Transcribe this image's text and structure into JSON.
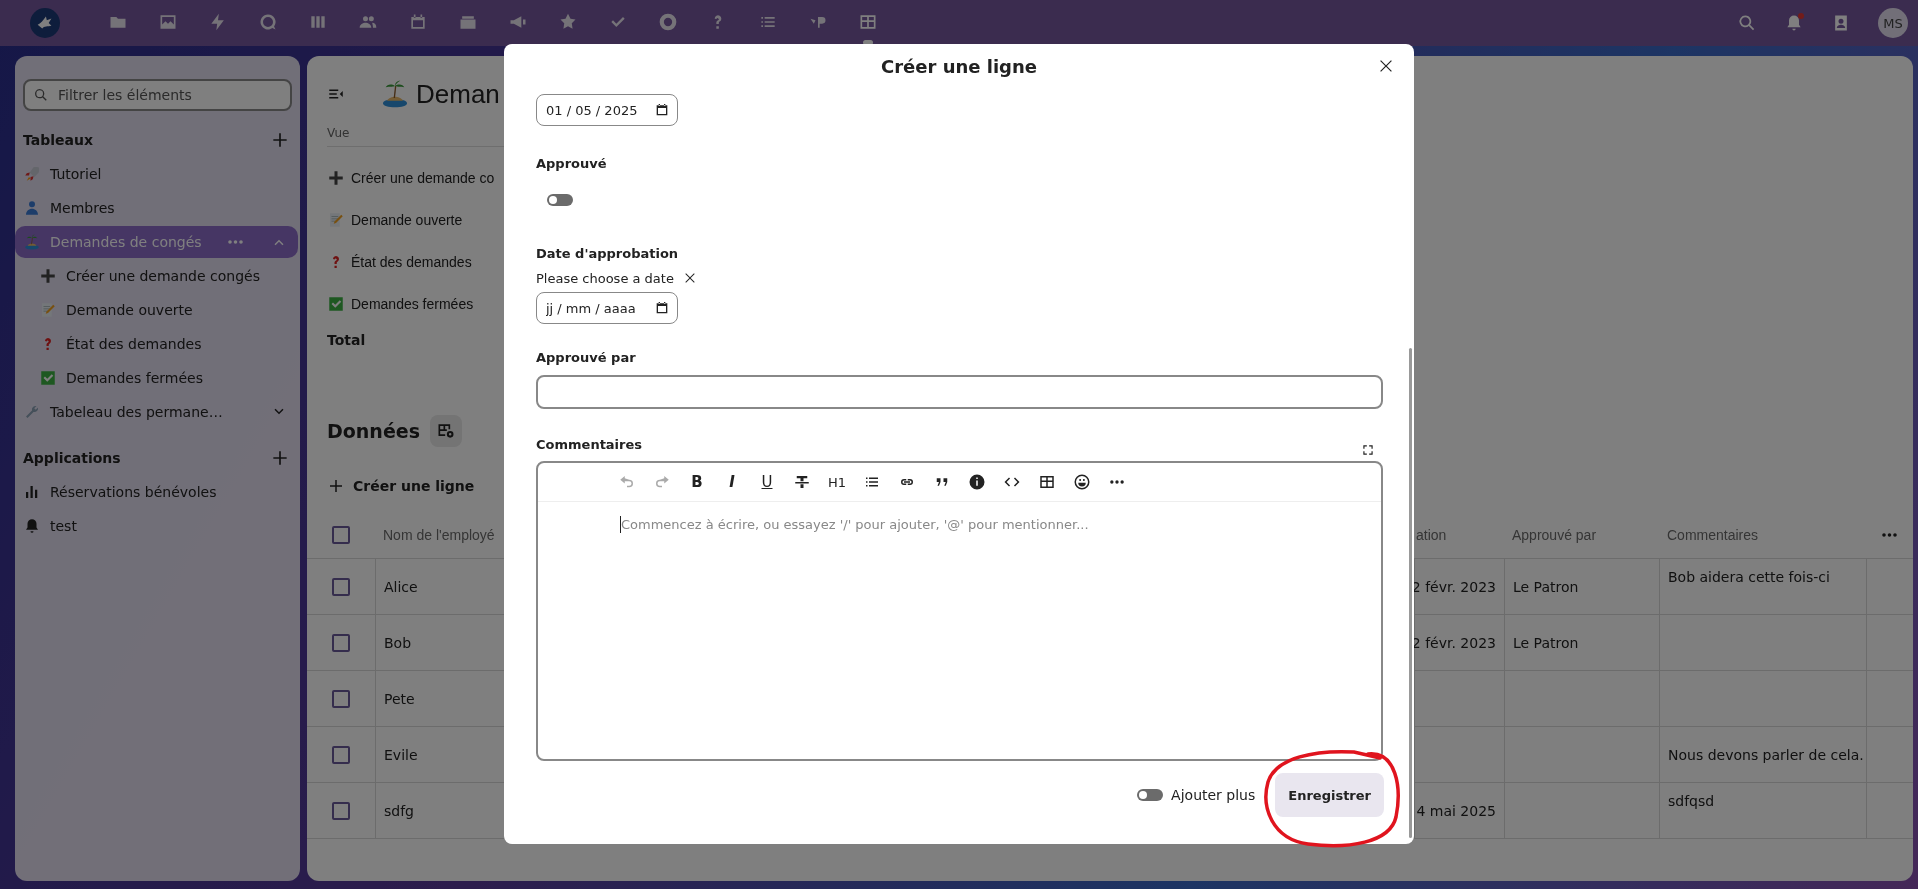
{
  "topbar": {
    "apps": [
      {
        "selected": false
      },
      {
        "selected": false
      },
      {
        "selected": false
      },
      {
        "selected": false
      },
      {
        "selected": false
      },
      {
        "selected": false
      },
      {
        "selected": false
      },
      {
        "selected": false
      },
      {
        "selected": false
      },
      {
        "selected": false
      },
      {
        "selected": false
      },
      {
        "selected": false
      },
      {
        "selected": false
      },
      {
        "selected": false
      },
      {
        "selected": false
      },
      {
        "selected": true
      }
    ],
    "notifications_unread": true,
    "avatar": "MS"
  },
  "sidebar": {
    "filter_placeholder": "Filtrer les éléments",
    "sections": [
      {
        "title": "Tableaux",
        "items": [
          {
            "label": "Tutoriel",
            "selected": false
          },
          {
            "label": "Membres",
            "selected": false
          },
          {
            "label": "Demandes de congés",
            "selected": true,
            "expanded": true,
            "children": [
              {
                "label": "Créer une demande congés"
              },
              {
                "label": "Demande ouverte"
              },
              {
                "label": "État des demandes"
              },
              {
                "label": "Demandes fermées"
              }
            ]
          },
          {
            "label": "Tabeleau des permane…",
            "selected": false,
            "expanded": false
          }
        ]
      },
      {
        "title": "Applications",
        "items": [
          {
            "label": "Réservations bénévoles",
            "selected": false
          },
          {
            "label": "test",
            "selected": false
          }
        ]
      }
    ]
  },
  "main": {
    "title": "Deman",
    "view_heading": "Vue",
    "views": [
      "Créer une demande co",
      "Demande ouverte",
      "État des demandes",
      "Demandes fermées"
    ],
    "total_label": "Total",
    "data_heading": "Données",
    "create_row": "Créer une ligne",
    "table": {
      "all_selected": false,
      "columns": {
        "name": "Nom de l'employé",
        "column_2": "ation",
        "approved_by": "Approuvé par",
        "comments": "Commentaires"
      },
      "rows": [
        {
          "selected": false,
          "name": "Alice",
          "column_2": "2 févr. 2023",
          "approved_by": "Le Patron",
          "comments": "Bob aidera cette fois-ci"
        },
        {
          "selected": false,
          "name": "Bob",
          "column_2": "2 févr. 2023",
          "approved_by": "Le Patron"
        },
        {
          "selected": false,
          "name": "Pete"
        },
        {
          "selected": false,
          "name": "Evile",
          "comments": "Nous devons parler de cela."
        },
        {
          "selected": false,
          "name": "sdfg",
          "column_2": "4 mai 2025",
          "comments": "sdfqsd"
        }
      ]
    }
  },
  "modal": {
    "title": "Créer une ligne",
    "fields": [
      {
        "kind": "date",
        "value": "01 / 05 / 2025"
      },
      {
        "kind": "toggle",
        "label": "Approuvé",
        "on": false
      },
      {
        "kind": "date",
        "label": "Date d'approbation",
        "hint": "Please choose a date",
        "placeholder": "jj / mm / aaaa"
      },
      {
        "kind": "text",
        "label": "Approuvé par"
      },
      {
        "kind": "editor",
        "label": "Commentaires",
        "placeholder": "Commencez à écrire, ou essayez '/' pour ajouter, '@' pour mentionner..."
      }
    ],
    "toolbar": [
      {
        "kind": "undo",
        "disabled": true
      },
      {
        "kind": "redo",
        "disabled": true
      },
      {
        "kind": "bold",
        "label": "B",
        "disabled": false
      },
      {
        "kind": "italic",
        "label": "I",
        "disabled": false
      },
      {
        "kind": "underline",
        "label": "U",
        "disabled": false
      },
      {
        "kind": "strike",
        "disabled": false
      },
      {
        "kind": "heading",
        "label": "H1",
        "disabled": false
      },
      {
        "kind": "list",
        "disabled": false
      },
      {
        "kind": "link",
        "disabled": false
      },
      {
        "kind": "quote",
        "disabled": false
      },
      {
        "kind": "info",
        "disabled": false
      },
      {
        "kind": "code",
        "disabled": false
      },
      {
        "kind": "table",
        "disabled": false
      },
      {
        "kind": "emoji",
        "disabled": false
      },
      {
        "kind": "more",
        "disabled": false
      }
    ],
    "add_more": {
      "label": "Ajouter plus",
      "on": false
    },
    "save": "Enregistrer"
  }
}
